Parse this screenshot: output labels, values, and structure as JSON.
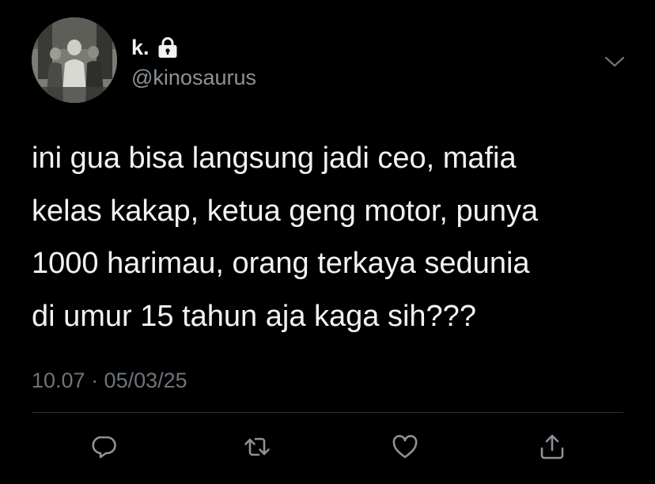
{
  "tweet": {
    "author": {
      "display_name": "k.",
      "username": "@kinosaurus",
      "protected_icon": "lock-icon",
      "avatar": "profile-photo"
    },
    "more_icon": "chevron-down-icon",
    "text": "ini gua bisa langsung jadi ceo, mafia\nkelas kakap, ketua geng motor, punya\n1000 harimau, orang terkaya sedunia\ndi umur 15 tahun aja kaga sih???",
    "meta": "10.07 · 05/03/25",
    "actions": {
      "reply_icon": "reply-icon",
      "retweet_icon": "retweet-icon",
      "like_icon": "heart-icon",
      "share_icon": "share-icon"
    }
  },
  "colors": {
    "background": "#000000",
    "text_primary": "#f2f2f2",
    "text_secondary": "#8b9299",
    "meta_text": "#6d747b",
    "divider": "#2f3336",
    "icon": "#8b9299"
  }
}
